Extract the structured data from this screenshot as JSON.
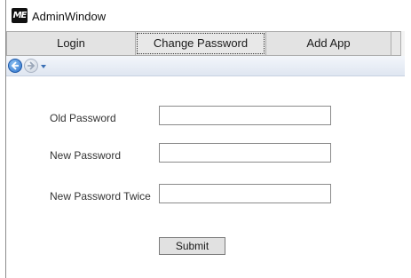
{
  "window": {
    "title": "AdminWindow",
    "logo_text": "ME"
  },
  "tabs": [
    {
      "label": "Login"
    },
    {
      "label": "Change Password",
      "active": true
    },
    {
      "label": "Add App"
    }
  ],
  "nav": {
    "back_icon": "back-arrow-icon",
    "forward_icon": "forward-arrow-icon",
    "dropdown_icon": "chevron-down-icon"
  },
  "form": {
    "old_password": {
      "label": "Old Password",
      "value": ""
    },
    "new_password": {
      "label": "New Password",
      "value": ""
    },
    "new_password_twice": {
      "label": "New Password Twice",
      "value": ""
    },
    "submit_label": "Submit"
  }
}
